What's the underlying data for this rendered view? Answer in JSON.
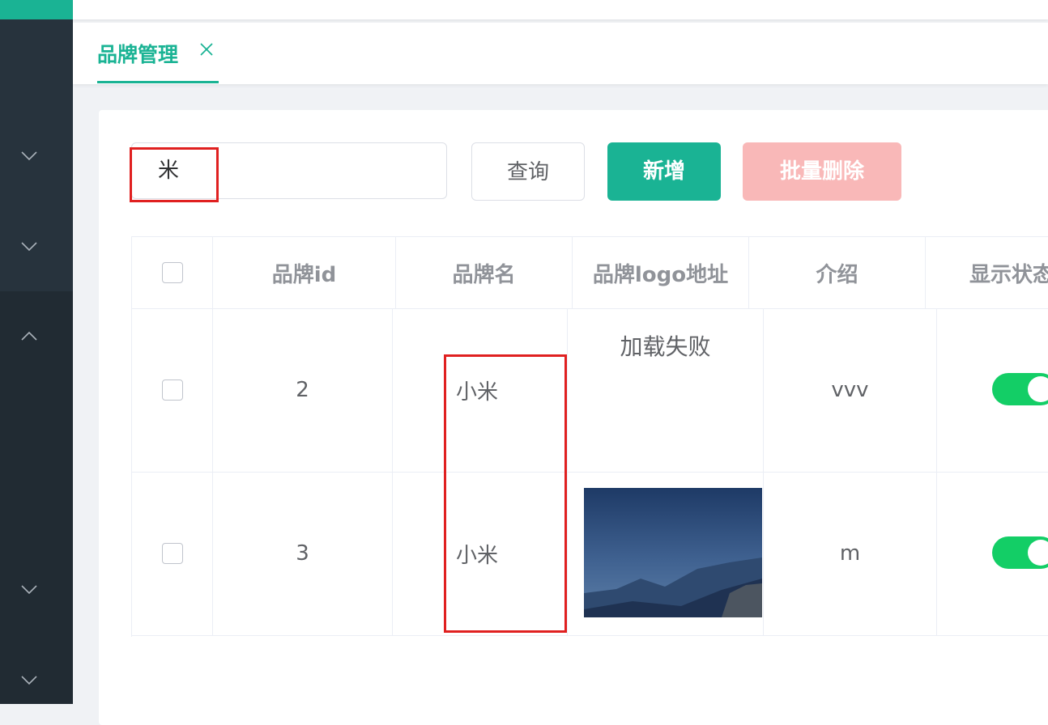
{
  "tab": {
    "label": "品牌管理"
  },
  "search": {
    "value": "米"
  },
  "buttons": {
    "query": "查询",
    "add": "新增",
    "batch_delete": "批量删除"
  },
  "table": {
    "columns": [
      "品牌id",
      "品牌名",
      "品牌logo地址",
      "介绍",
      "显示状态"
    ],
    "rows": [
      {
        "id": "2",
        "name": "小米",
        "logo": "加载失败",
        "intro": "vvv",
        "status_on": true
      },
      {
        "id": "3",
        "name": "小米",
        "logo": "",
        "intro": "m",
        "status_on": true
      }
    ]
  },
  "colors": {
    "accent": "#1ab394",
    "switch_on": "#13ce66",
    "danger_light": "#f9b8b8",
    "highlight": "#e02020"
  },
  "icons": {
    "sidebar_menu": [
      "chevron-down-icon",
      "chevron-down-icon",
      "chevron-up-icon",
      "chevron-down-icon",
      "chevron-down-icon"
    ],
    "tab_close": "close-icon"
  }
}
